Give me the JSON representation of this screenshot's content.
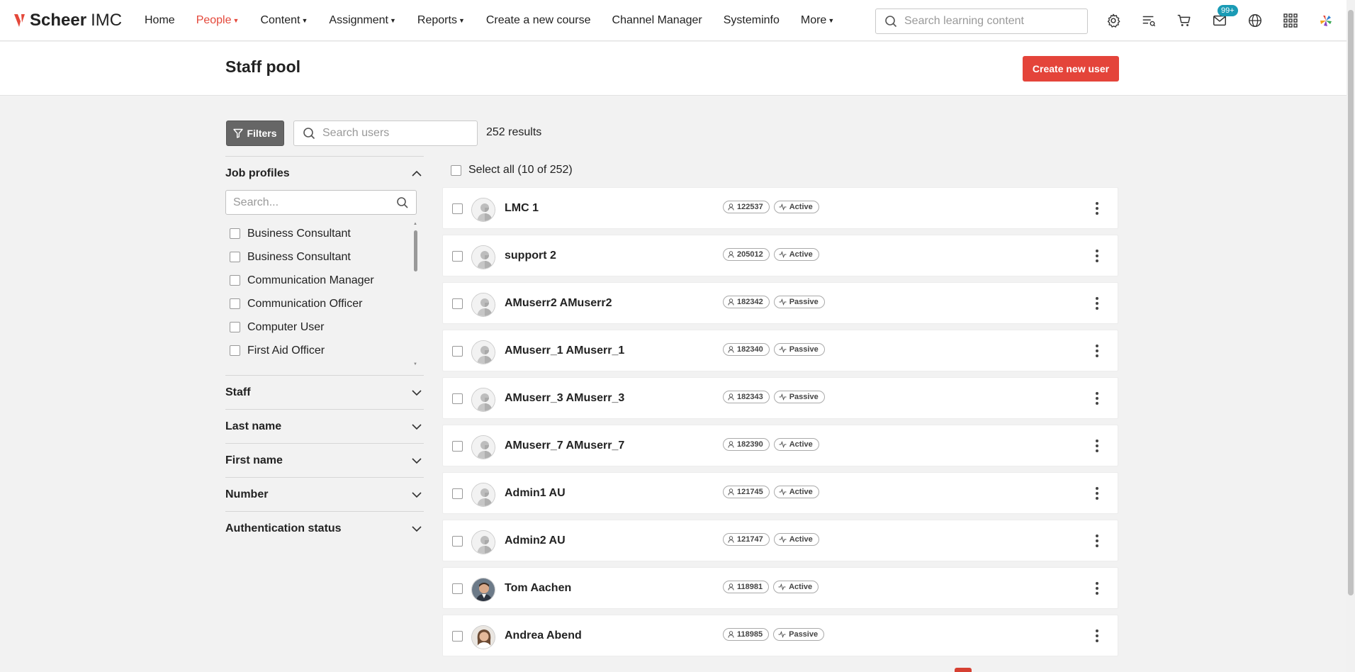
{
  "app": {
    "logo_bold": "Scheer",
    "logo_light": "IMC",
    "brand_color": "#e4483a"
  },
  "nav": {
    "items": [
      {
        "label": "Home",
        "dropdown": false,
        "active": false
      },
      {
        "label": "People",
        "dropdown": true,
        "active": true
      },
      {
        "label": "Content",
        "dropdown": true,
        "active": false
      },
      {
        "label": "Assignment",
        "dropdown": true,
        "active": false
      },
      {
        "label": "Reports",
        "dropdown": true,
        "active": false
      },
      {
        "label": "Create a new course",
        "dropdown": false,
        "active": false
      },
      {
        "label": "Channel Manager",
        "dropdown": false,
        "active": false
      },
      {
        "label": "Systeminfo",
        "dropdown": false,
        "active": false
      },
      {
        "label": "More",
        "dropdown": true,
        "active": false
      }
    ],
    "search_placeholder": "Search learning content",
    "icons": [
      "gear-icon",
      "task-list-icon",
      "cart-icon",
      "mail-icon",
      "globe-icon",
      "app-grid-icon",
      "brand-logo-icon"
    ],
    "mail_badge": "99+"
  },
  "page": {
    "title": "Staff pool",
    "create_button": "Create new user"
  },
  "toolbar": {
    "filters_label": "Filters",
    "search_placeholder": "Search users",
    "results": "252 results"
  },
  "filters": {
    "job_profiles": {
      "title": "Job profiles",
      "search_placeholder": "Search...",
      "items": [
        "Business Consultant",
        "Business Consultant",
        "Communication Manager",
        "Communication Officer",
        "Computer User",
        "First Aid Officer"
      ]
    },
    "sections": [
      "Staff",
      "Last name",
      "First name",
      "Number",
      "Authentication status"
    ]
  },
  "list": {
    "select_all": "Select all (10 of 252)",
    "users": [
      {
        "name": "LMC 1",
        "id": "122537",
        "status": "Active",
        "avatar": "default"
      },
      {
        "name": "support 2",
        "id": "205012",
        "status": "Active",
        "avatar": "default"
      },
      {
        "name": "AMuserr2 AMuserr2",
        "id": "182342",
        "status": "Passive",
        "avatar": "default"
      },
      {
        "name": "AMuserr_1 AMuserr_1",
        "id": "182340",
        "status": "Passive",
        "avatar": "default"
      },
      {
        "name": "AMuserr_3 AMuserr_3",
        "id": "182343",
        "status": "Passive",
        "avatar": "default"
      },
      {
        "name": "AMuserr_7 AMuserr_7",
        "id": "182390",
        "status": "Active",
        "avatar": "default"
      },
      {
        "name": "Admin1 AU",
        "id": "121745",
        "status": "Active",
        "avatar": "default"
      },
      {
        "name": "Admin2 AU",
        "id": "121747",
        "status": "Active",
        "avatar": "default"
      },
      {
        "name": "Tom Aachen",
        "id": "118981",
        "status": "Active",
        "avatar": "photo-man"
      },
      {
        "name": "Andrea Abend",
        "id": "118985",
        "status": "Passive",
        "avatar": "photo-woman"
      }
    ]
  }
}
